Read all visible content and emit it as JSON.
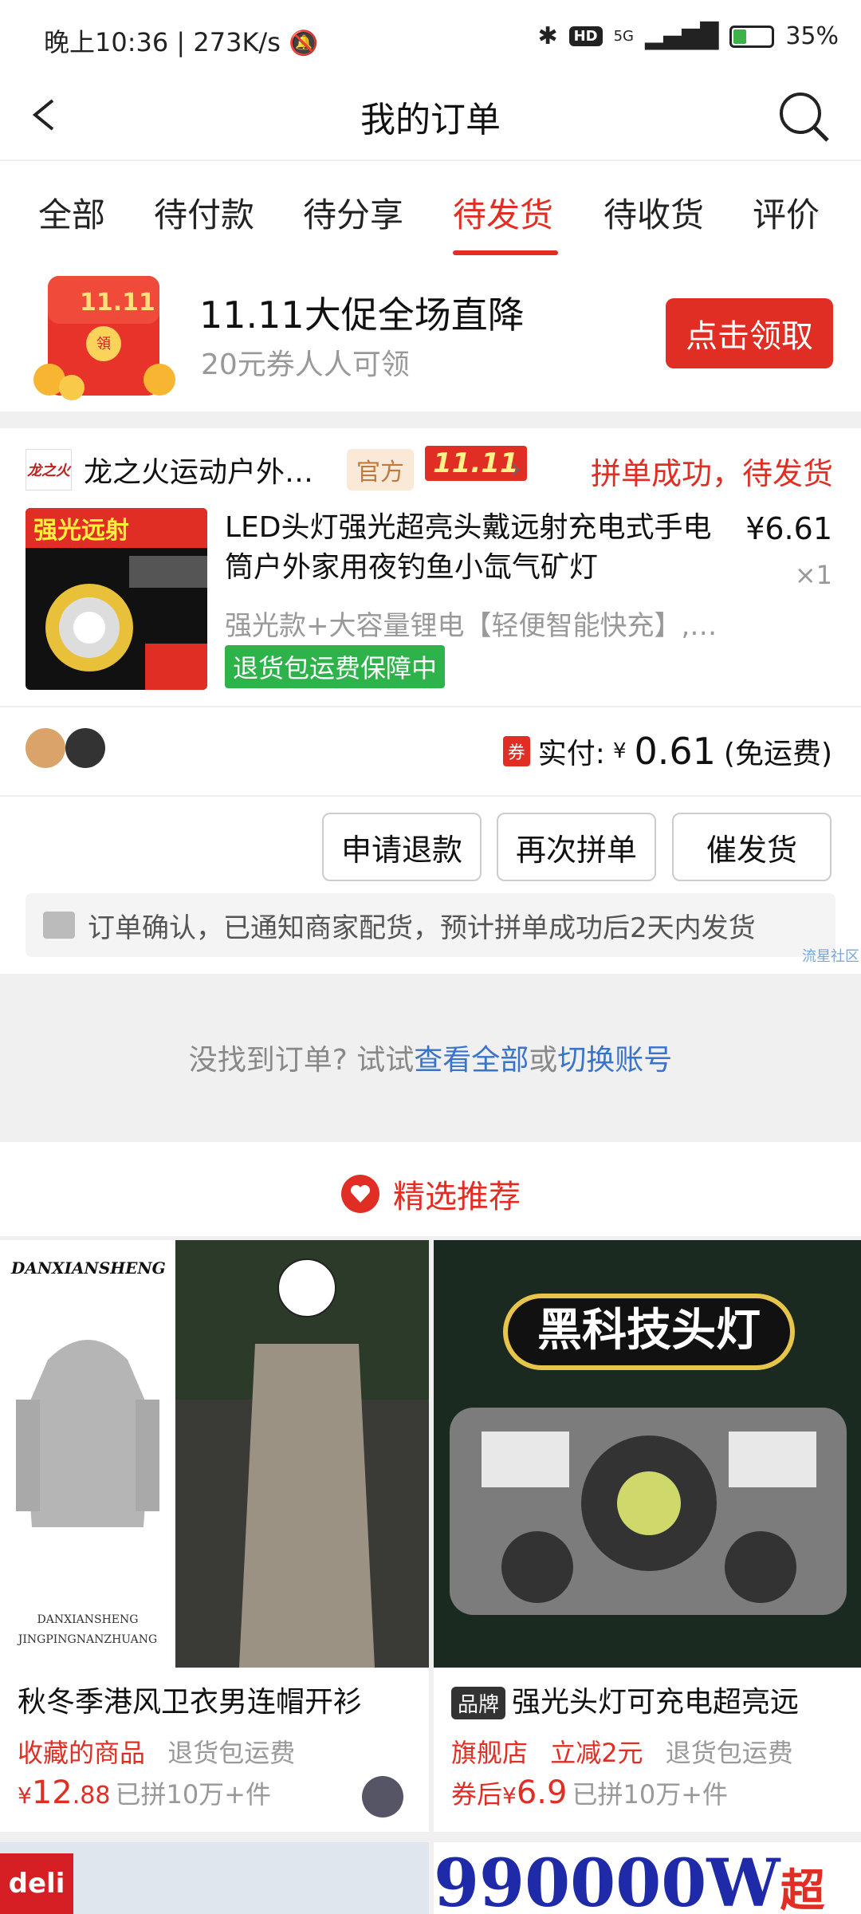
{
  "status_bar": {
    "time": "晚上10:36",
    "speed": "273K/s",
    "network": "5G",
    "hd": "HD",
    "battery": "35%",
    "battery_level": 0.35
  },
  "header": {
    "title": "我的订单"
  },
  "tabs": [
    {
      "label": "全部"
    },
    {
      "label": "待付款"
    },
    {
      "label": "待分享"
    },
    {
      "label": "待发货",
      "active": true
    },
    {
      "label": "待收货"
    },
    {
      "label": "评价"
    }
  ],
  "promo": {
    "badge": "11.11",
    "title": "11.11大促全场直降",
    "subtitle": "20元券人人可领",
    "button": "点击领取"
  },
  "order": {
    "store_logo_text": "龙之火",
    "store_name": "龙之火运动户外…",
    "tag_official": "官方",
    "tag_event": "11.11",
    "status": "拼单成功，待发货",
    "product_image_text": "强光远射",
    "product_title": "LED头灯强光超亮头戴远射充电式手电筒户外家用夜钓鱼小氙气矿灯",
    "price": "¥6.61",
    "quantity": "×1",
    "spec": "强光款+大容量锂电【轻便智能快充】,…",
    "guarantee": "退货包运费保障中",
    "coupon_icon": "券",
    "paid_label": "实付:",
    "paid_currency": "¥",
    "paid_amount": "0.61",
    "shipping_note": "(免运费)",
    "buttons": [
      "申请退款",
      "再次拼单",
      "催发货"
    ],
    "notice": "订单确认，已通知商家配货，预计拼单成功后2天内发货"
  },
  "watermark": "流星社区",
  "not_found": {
    "prefix": "没找到订单? 试试",
    "link1": "查看全部",
    "mid": "或",
    "link2": "切换账号"
  },
  "recommend": {
    "title": "精选推荐"
  },
  "products": [
    {
      "image_brand": "DANXIANSHENG",
      "image_caption1": "DANXIANSHENG",
      "image_caption2": "JINGPINGNANZHUANG",
      "title": "秋冬季港风卫衣男连帽开衫",
      "tag1": "收藏的商品",
      "tag2": "退货包运费",
      "price_currency": "¥",
      "price_int": "12",
      "price_dec": ".88",
      "sold": "已拼10万+件"
    },
    {
      "image_banner": "黑科技头灯",
      "brand_tag": "品牌",
      "title": "强光头灯可充电超亮远",
      "tag1": "旗舰店",
      "tag2": "立减2元",
      "tag3": "退货包运费",
      "price_prefix": "券后",
      "price_currency": "¥",
      "price_value": "6.9",
      "sold": "已拼10万+件"
    }
  ],
  "bottom": {
    "left_brand": "deli",
    "right_text": "990000W",
    "right_suffix": "超亮"
  }
}
